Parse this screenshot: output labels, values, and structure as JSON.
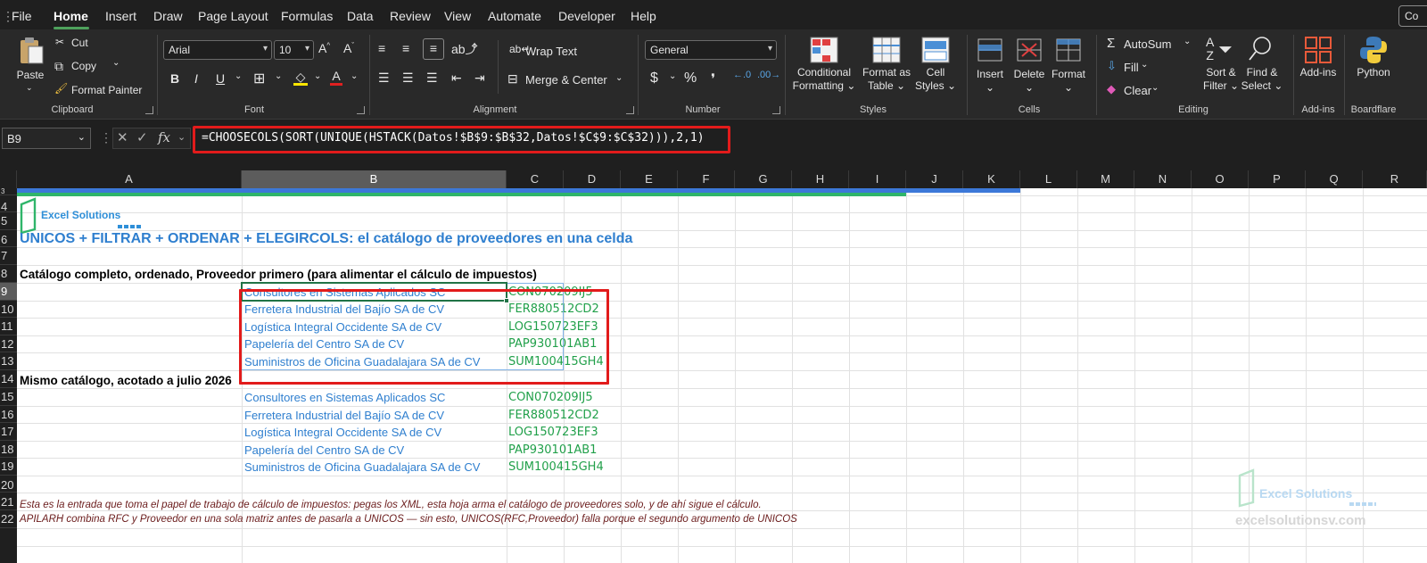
{
  "menu": {
    "items": [
      "File",
      "Home",
      "Insert",
      "Draw",
      "Page Layout",
      "Formulas",
      "Data",
      "Review",
      "View",
      "Automate",
      "Developer",
      "Help"
    ],
    "active": "Home",
    "corner_button": "Co"
  },
  "ribbon": {
    "clipboard": {
      "label": "Clipboard",
      "paste": "Paste",
      "cut": "Cut",
      "copy": "Copy",
      "format_painter": "Format Painter"
    },
    "font": {
      "label": "Font",
      "font_name": "Arial",
      "font_size": "10"
    },
    "alignment": {
      "label": "Alignment",
      "wrap_text": "Wrap Text",
      "merge_center": "Merge & Center"
    },
    "number": {
      "label": "Number",
      "format": "General"
    },
    "styles": {
      "label": "Styles",
      "conditional": [
        "Conditional",
        "Formatting"
      ],
      "format_table": [
        "Format as",
        "Table"
      ],
      "cell_styles": [
        "Cell",
        "Styles"
      ]
    },
    "cells": {
      "label": "Cells",
      "insert": "Insert",
      "delete": "Delete",
      "format": "Format"
    },
    "editing": {
      "label": "Editing",
      "autosum": "AutoSum",
      "fill": "Fill",
      "clear": "Clear",
      "sort_filter": [
        "Sort &",
        "Filter"
      ],
      "find_select": [
        "Find &",
        "Select"
      ]
    },
    "addins": {
      "label": "Add-ins",
      "button": "Add-ins"
    },
    "boardflare": {
      "label": "Boardflare",
      "button": "Python"
    }
  },
  "formula_bar": {
    "name_box": "B9",
    "fx": "fx",
    "formula": "=CHOOSECOLS(SORT(UNIQUE(HSTACK(Datos!$B$9:$B$32,Datos!$C$9:$C$32))),2,1)"
  },
  "columns": [
    "A",
    "B",
    "C",
    "D",
    "E",
    "F",
    "G",
    "H",
    "I",
    "J",
    "K",
    "L",
    "M",
    "N",
    "O",
    "P",
    "Q",
    "R"
  ],
  "selected_column": "B",
  "rows": [
    "3",
    "4",
    "5",
    "6",
    "7",
    "8",
    "9",
    "10",
    "11",
    "12",
    "13",
    "14",
    "15",
    "16",
    "17",
    "18",
    "19",
    "20",
    "21",
    "22"
  ],
  "selected_row": "9",
  "sheet": {
    "logo_text": "Excel Solutions",
    "title": "UNICOS + FILTRAR + ORDENAR + ELEGIRCOLS: el catálogo de proveedores en una celda",
    "section1": "Catálogo completo, ordenado, Proveedor primero (para alimentar el cálculo de impuestos)",
    "table1": [
      [
        "Consultores en Sistemas Aplicados SC",
        "CON070209IJ5"
      ],
      [
        "Ferretera Industrial del Bajío SA de CV",
        "FER880512CD2"
      ],
      [
        "Logística Integral Occidente SA de CV",
        "LOG150723EF3"
      ],
      [
        "Papelería del Centro SA de CV",
        "PAP930101AB1"
      ],
      [
        "Suministros de Oficina Guadalajara SA de CV",
        "SUM100415GH4"
      ]
    ],
    "section2": "Mismo catálogo, acotado a julio 2026",
    "table2": [
      [
        "Consultores en Sistemas Aplicados SC",
        "CON070209IJ5"
      ],
      [
        "Ferretera Industrial del Bajío SA de CV",
        "FER880512CD2"
      ],
      [
        "Logística Integral Occidente SA de CV",
        "LOG150723EF3"
      ],
      [
        "Papelería del Centro SA de CV",
        "PAP930101AB1"
      ],
      [
        "Suministros de Oficina Guadalajara SA de CV",
        "SUM100415GH4"
      ]
    ],
    "note1": "Esta es la entrada que toma el papel de trabajo de cálculo de impuestos: pegas los XML, esta hoja arma el catálogo de proveedores solo, y de ahí sigue el cálculo.",
    "note2": "APILARH combina RFC y Proveedor en una sola matriz antes de pasarla a UNICOS — sin esto, UNICOS(RFC,Proveedor) falla porque el segundo argumento de UNICOS",
    "watermark_logo": "Excel Solutions",
    "watermark_url": "excelsolutionsv.com"
  },
  "colors": {
    "accent_green": "#217346",
    "highlight_red": "#e21b1b",
    "provider_blue": "#2f7fcf",
    "rfc_green": "#21a04a"
  }
}
